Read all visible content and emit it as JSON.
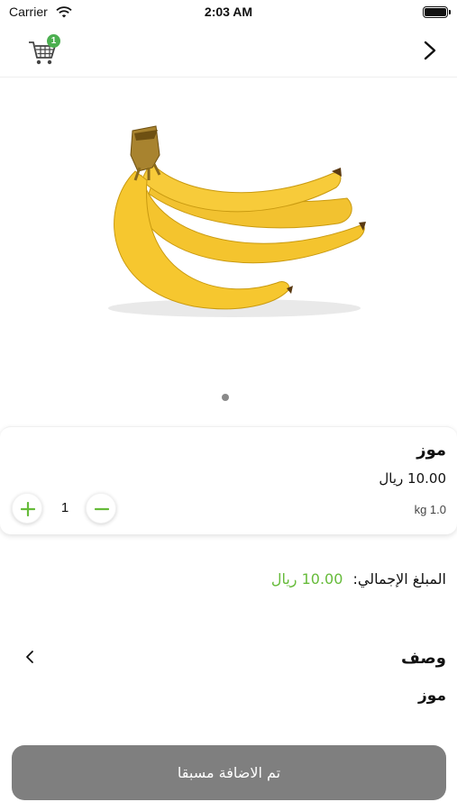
{
  "status_bar": {
    "carrier": "Carrier",
    "time": "2:03 AM",
    "icons": [
      "wifi-icon",
      "battery-icon"
    ]
  },
  "nav": {
    "cart_badge": "1",
    "icons": [
      "cart-icon",
      "chevron-right-icon"
    ]
  },
  "product": {
    "image_icon": "banana-image",
    "carousel_pages": 1,
    "name": "موز",
    "price": "10.00 ريال",
    "weight": "kg 1.0",
    "quantity": "1"
  },
  "total": {
    "label": "المبلغ الإجمالي:",
    "value": "10.00 ريال"
  },
  "description": {
    "label": "وصف",
    "text": "موز"
  },
  "add_button": {
    "label": "تم الاضافة مسبقا"
  },
  "colors": {
    "accent_green": "#66bb3a",
    "badge_green": "#4caf50",
    "button_disabled": "#7f7f7f"
  }
}
